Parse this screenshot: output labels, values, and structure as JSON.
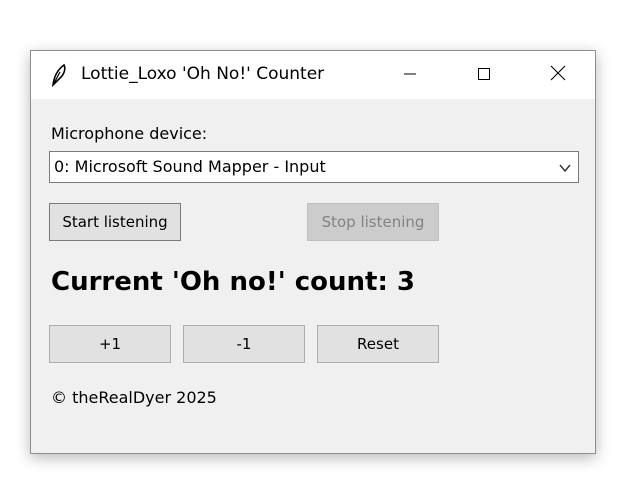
{
  "window": {
    "title": "Lottie_Loxo 'Oh No!' Counter"
  },
  "microphone": {
    "label": "Microphone device:",
    "selected": "0: Microsoft Sound Mapper - Input"
  },
  "controls": {
    "start_label": "Start listening",
    "stop_label": "Stop listening"
  },
  "counter": {
    "text": "Current 'Oh no!' count: 3",
    "value": 3
  },
  "adjust": {
    "plus_label": "+1",
    "minus_label": "-1",
    "reset_label": "Reset"
  },
  "footer": {
    "copyright": "© theRealDyer 2025"
  },
  "icons": {
    "app": "feather-icon",
    "minimize": "minimize-icon",
    "maximize": "maximize-icon",
    "close": "close-icon",
    "dropdown": "chevron-down-icon"
  },
  "colors": {
    "window_bg": "#f0f0f0",
    "titlebar_bg": "#ffffff",
    "button_bg": "#e1e1e1",
    "disabled_text": "#838383"
  }
}
